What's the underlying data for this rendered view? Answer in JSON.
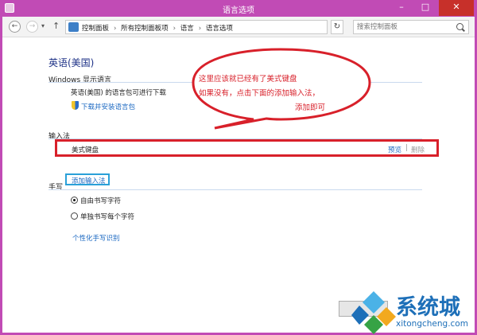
{
  "window": {
    "title": "语言选项",
    "min_icon": "minimize-icon",
    "max_icon": "maximize-icon",
    "close_icon": "close-icon"
  },
  "address_bar": {
    "breadcrumbs": [
      "控制面板",
      "所有控制面板项",
      "语言",
      "语言选项"
    ],
    "search_placeholder": "搜索控制面板"
  },
  "page": {
    "language_title": "英语(美国)",
    "display_language": {
      "heading": "Windows 显示语言",
      "status": "英语(美国) 的语言包可进行下载",
      "download_link": "下载并安装语言包"
    },
    "input_method": {
      "heading": "输入法",
      "items": [
        {
          "name": "美式键盘",
          "preview": "预览",
          "delete": "删除"
        }
      ],
      "add_link": "添加输入法"
    },
    "handwriting": {
      "heading": "手写",
      "options": [
        {
          "label": "自由书写字符",
          "selected": true
        },
        {
          "label": "单独书写每个字符",
          "selected": false
        }
      ],
      "personalize_link": "个性化手写识别"
    }
  },
  "annotation": {
    "line1": "这里应该就已经有了美式键盘",
    "line2": "如果没有，点击下面的添加输入法，",
    "line3": "添加即可",
    "color": "#d8202a"
  },
  "watermark": {
    "main": "系统城",
    "sub": "xitongcheng.com"
  }
}
